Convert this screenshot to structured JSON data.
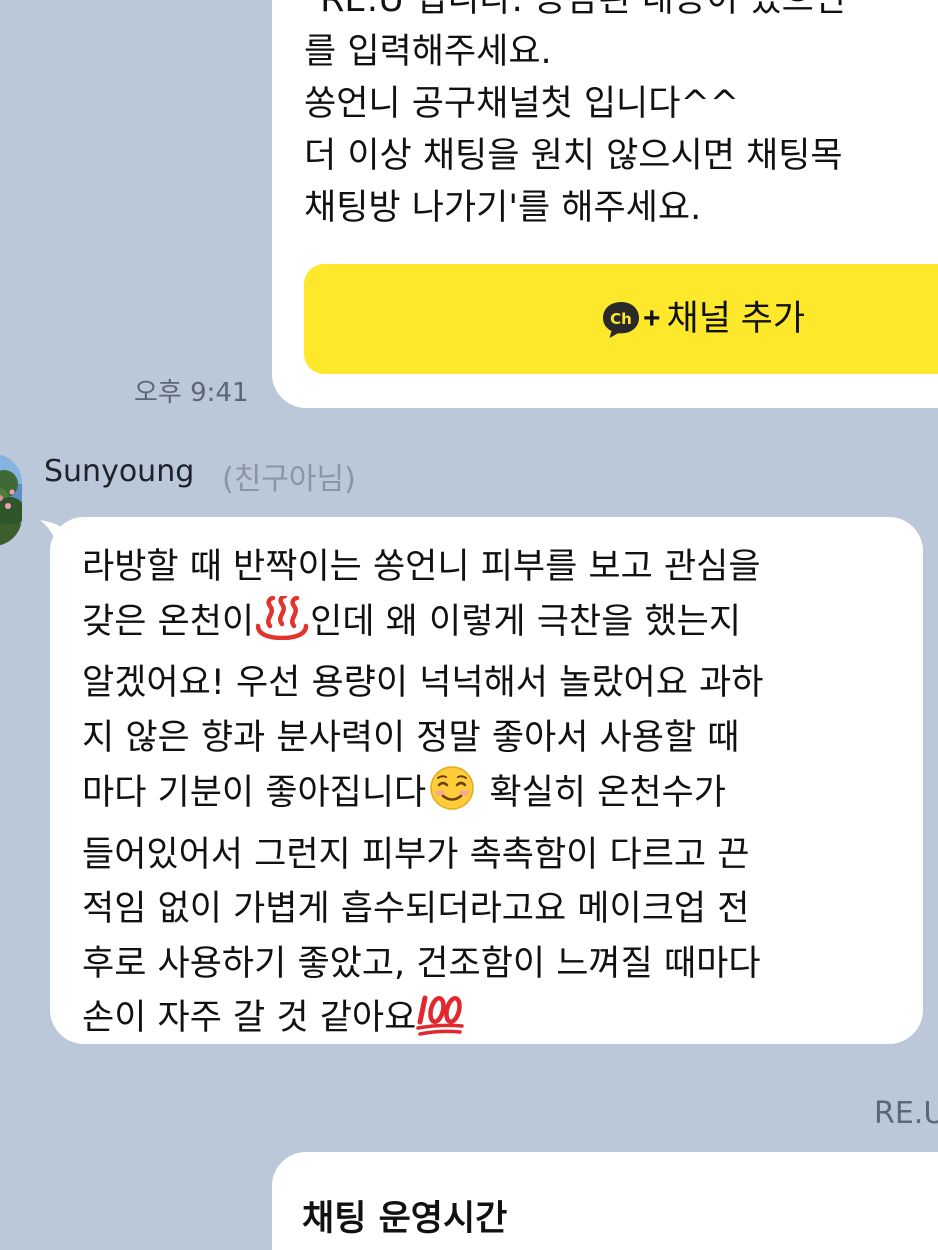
{
  "channel_message": {
    "partial_top_line": "\"RE:U 입니다. 공감된 내용이 있으면",
    "lines": [
      "를 입력해주세요.",
      "쏭언니 공구채널첫 입니다^^",
      "더 이상 채팅을 원치 않으시면 채팅목",
      "채팅방 나가기'를 해주세요."
    ],
    "button": {
      "icon": "ch-icon",
      "plus": "+",
      "label": "채널 추가"
    },
    "time": "오후 9:41"
  },
  "sender": {
    "name": "Sunyoung",
    "tag": "(친구아님)"
  },
  "message": {
    "lines": [
      "라방할 때 반짝이는 쏭언니 피부를 보고 관심을",
      " 갖은 온천이",
      "인데 왜 이렇게 극찬을 했는지",
      "알겠어요! 우선 용량이 넉넉해서 놀랐어요 과하",
      "지 않은 향과 분사력이 정말 좋아서 사용할 때",
      "마다 기분이 좋아집니다",
      " 확실히 온천수가",
      "들어있어서 그런지 피부가 촉촉함이 다르고 끈",
      "적임 없이 가볍게 흡수되더라고요 메이크업 전",
      "후로 사용하기 좋았고, 건조함이 느껴질 때마다",
      " 손이 자주 갈 것 같아요"
    ],
    "emojis": {
      "hot_springs": "hot-springs-emoji",
      "smiling": "smiling-face-emoji",
      "hundred": "hundred-points-emoji"
    }
  },
  "next_sender_partial": "RE.U",
  "hours_card": {
    "title": "채팅 운영시간"
  },
  "colors": {
    "background": "#bac8da",
    "bubble": "#ffffff",
    "button": "#fde82c"
  }
}
